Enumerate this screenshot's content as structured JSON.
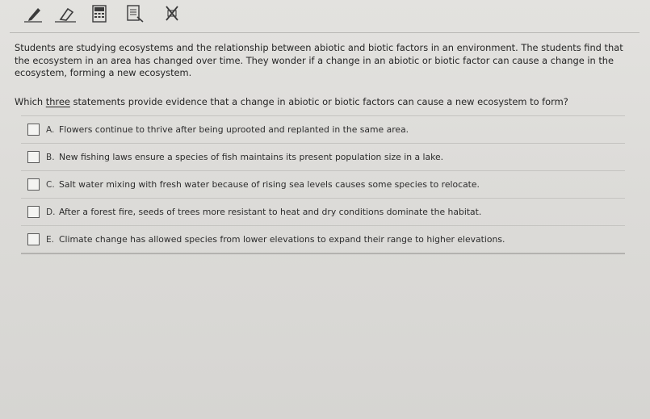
{
  "toolbar": {
    "tools": [
      {
        "name": "pencil-icon"
      },
      {
        "name": "eraser-icon"
      },
      {
        "name": "calculator-icon"
      },
      {
        "name": "reference-sheet-icon"
      },
      {
        "name": "answer-eliminator-icon"
      }
    ],
    "icon_color": "#3b3b3b"
  },
  "question": {
    "stem": "Students are studying ecosystems and the relationship between abiotic and biotic factors in an environment. The students find that the ecosystem in an area has changed over time. They wonder if a change in an abiotic or biotic factor can cause a change in the ecosystem, forming a new ecosystem.",
    "prompt_before": "Which ",
    "prompt_emphasis": "three",
    "prompt_after": " statements provide evidence that a change in abiotic or biotic factors can cause a new ecosystem to form?"
  },
  "choices": [
    {
      "letter": "A.",
      "text": "Flowers continue to thrive after being uprooted and replanted in the same area.",
      "checked": false
    },
    {
      "letter": "B.",
      "text": "New fishing laws ensure a species of fish maintains its present population size in a lake.",
      "checked": false
    },
    {
      "letter": "C.",
      "text": "Salt water mixing with fresh water because of rising sea levels causes some species to relocate.",
      "checked": false
    },
    {
      "letter": "D.",
      "text": "After a forest fire, seeds of trees more resistant to heat and dry conditions dominate the habitat.",
      "checked": false
    },
    {
      "letter": "E.",
      "text": "Climate change has allowed species from lower elevations to expand their range to higher elevations.",
      "checked": false
    }
  ]
}
